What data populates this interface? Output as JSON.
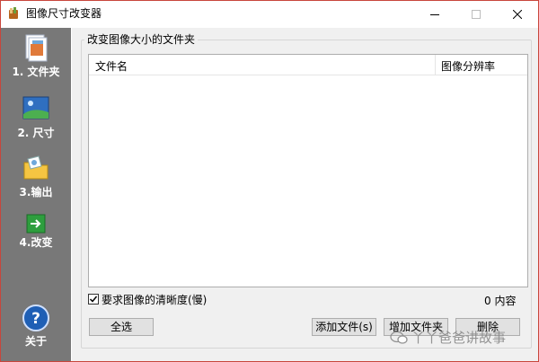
{
  "window": {
    "title": "图像尺寸改变器"
  },
  "sidebar": {
    "steps": [
      {
        "label": "1. 文件夹",
        "icon": "folder-documents-icon"
      },
      {
        "label": "2. 尺寸",
        "icon": "landscape-picture-icon"
      },
      {
        "label": "3.输出",
        "icon": "output-folder-icon"
      },
      {
        "label": "4.改变",
        "icon": "green-arrow-icon"
      }
    ],
    "about": {
      "label": "关于",
      "icon": "help-icon"
    }
  },
  "main": {
    "group_title": "改变图像大小的文件夹",
    "columns": [
      "文件名",
      "图像分辨率"
    ],
    "rows": [],
    "require_clarity_label": "要求图像的清晰度(慢)",
    "require_clarity_checked": true,
    "count_text": "0 内容",
    "buttons": {
      "select_all": "全选",
      "add_file": "添加文件(s)",
      "add_folder": "增加文件夹",
      "delete": "删除"
    }
  },
  "watermark": "丫丫爸爸讲故事",
  "colors": {
    "sidebar_bg": "#787878",
    "window_border": "#c8463c",
    "panel_bg": "#f0f0f0"
  }
}
